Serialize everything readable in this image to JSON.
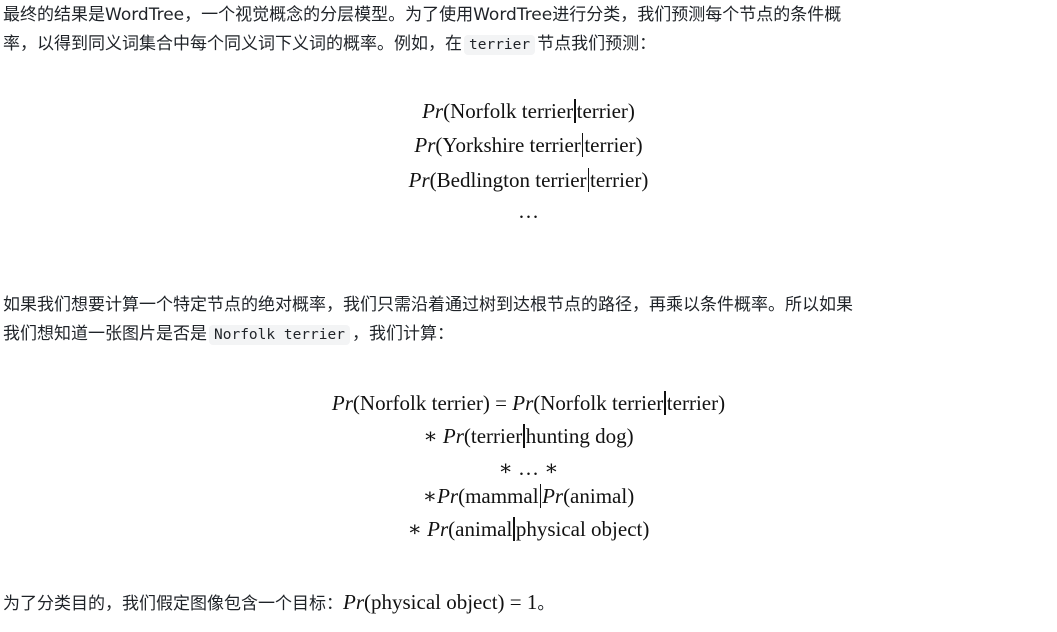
{
  "p1": {
    "line1": "最终的结果是WordTree，一个视觉概念的分层模型。为了使用WordTree进行分类，我们预测每个节点的条件概",
    "line2_pre": "率，以得到同义词集合中每个同义词下义词的概率。例如，在",
    "line2_code": "terrier",
    "line2_post": "节点我们预测："
  },
  "eq1": {
    "pr": "Pr",
    "lines": [
      {
        "left": "(Norfolk terrier",
        "right": "terrier)"
      },
      {
        "left": "(Yorkshire terrier",
        "right": "terrier)"
      },
      {
        "left": "(Bedlington terrier",
        "right": "terrier)"
      }
    ],
    "ellipsis": "…"
  },
  "p2": {
    "line1": "如果我们想要计算一个特定节点的绝对概率，我们只需沿着通过树到达根节点的路径，再乘以条件概率。所以如果",
    "line2_pre": "我们想知道一张图片是否是",
    "line2_code": "Norfolk terrier",
    "line2_post": "，我们计算："
  },
  "eq2": {
    "pr": "Pr",
    "line1_a": "(Norfolk terrier) = ",
    "line1_b": "(Norfolk terrier",
    "line1_c": "terrier)",
    "line2_star": "∗ ",
    "line2_a": "(terrier",
    "line2_b": "hunting dog)",
    "line3": "∗ … ∗",
    "line4_star": "∗",
    "line4_a": "(mammal",
    "line4_b": "(animal)",
    "line5_star": "∗ ",
    "line5_a": "(animal",
    "line5_b": "physical object)"
  },
  "p3": {
    "text_pre": "为了分类目的，我们假定图像包含一个目标：",
    "pr": "Pr",
    "math_rest": "(physical object) = 1",
    "text_post": "。"
  }
}
